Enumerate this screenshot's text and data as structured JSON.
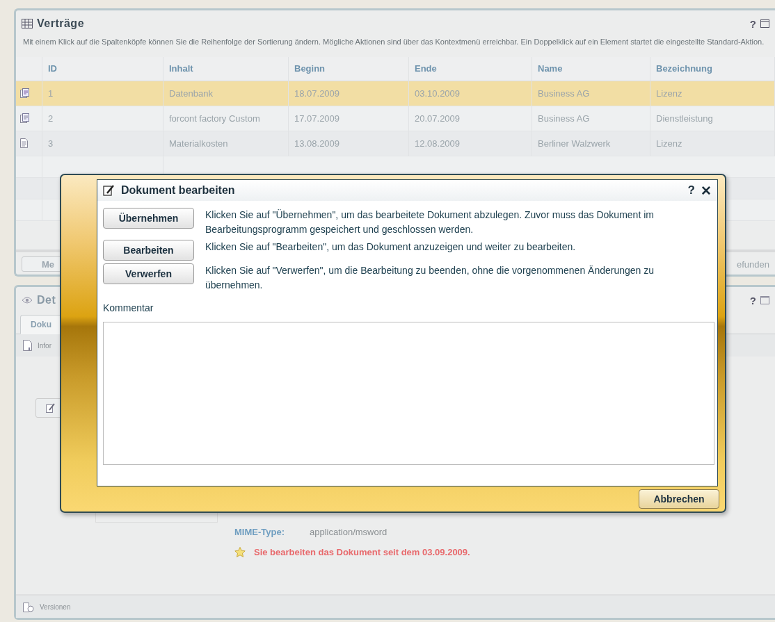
{
  "contracts_panel": {
    "title": "Verträge",
    "description": "Mit einem Klick auf die Spaltenköpfe können Sie die Reihenfolge der Sortierung ändern. Mögliche Aktionen sind über das Kontextmenü erreichbar. Ein Doppelklick auf ein Element startet die eingestellte Standard-Aktion.",
    "columns": [
      "ID",
      "Inhalt",
      "Beginn",
      "Ende",
      "Name",
      "Bezeichnung"
    ],
    "rows": [
      {
        "kind": "contract",
        "selected": true,
        "cells": [
          "1",
          "Datenbank",
          "18.07.2009",
          "03.10.2009",
          "Business AG",
          "Lizenz"
        ]
      },
      {
        "kind": "contract",
        "selected": false,
        "cells": [
          "2",
          "forcont factory Custom",
          "17.07.2009",
          "20.07.2009",
          "Business AG",
          "Dienstleistung"
        ]
      },
      {
        "kind": "document",
        "selected": false,
        "cells": [
          "3",
          "Materialkosten",
          "13.08.2009",
          "12.08.2009",
          "Berliner Walzwerk",
          "Lizenz"
        ]
      }
    ],
    "footer_button": "Me",
    "footer_status": "efunden"
  },
  "details_panel": {
    "title": "Det",
    "tabs": [
      {
        "label": "Doku",
        "selected": true
      }
    ],
    "toolbar_item": "Infor",
    "mime_label": "MIME-Type:",
    "mime_value": "application/msword",
    "notice": "Sie bearbeiten das Dokument seit dem 03.09.2009.",
    "footer_item": "Versionen"
  },
  "dialog": {
    "title": "Dokument bearbeiten",
    "help": "?",
    "close": "✕",
    "actions": [
      {
        "label": "Übernehmen",
        "description": "Klicken Sie auf \"Übernehmen\", um das bearbeitete Dokument abzulegen. Zuvor muss das Dokument im Bearbeitungsprogramm gespeichert und geschlossen werden."
      },
      {
        "label": "Bearbeiten",
        "description": "Klicken Sie auf \"Bearbeiten\", um das Dokument anzuzeigen und weiter zu bearbeiten."
      },
      {
        "label": "Verwerfen",
        "description": "Klicken Sie auf \"Verwerfen\", um die Bearbeitung zu beenden, ohne die vorgenommenen Änderungen zu übernehmen."
      }
    ],
    "comment_label": "Kommentar",
    "cancel": "Abbrechen"
  },
  "panel_help": "?"
}
